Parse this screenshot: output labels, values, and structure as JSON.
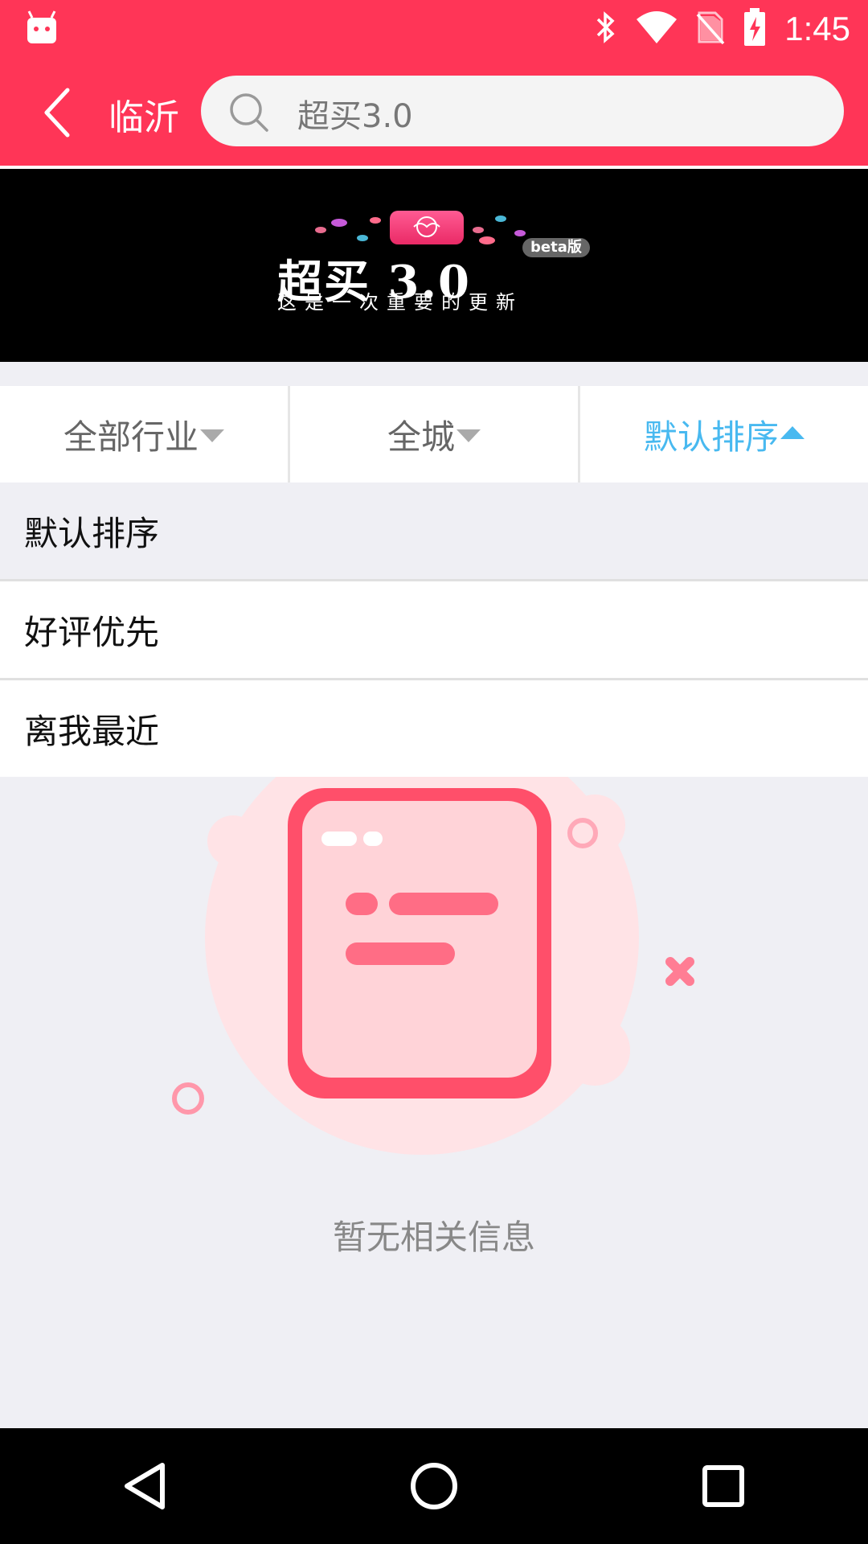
{
  "status_bar": {
    "time": "1:45",
    "icons": [
      "android-icon",
      "bluetooth-icon",
      "wifi-icon",
      "no-sim-icon",
      "battery-charging-icon"
    ]
  },
  "app_bar": {
    "city": "临沂",
    "search_text": "超买3.0",
    "accent_color": "#ff3557"
  },
  "banner": {
    "title": "超买 3.0",
    "badge": "beta版",
    "subtitle": "这是一次重要的更新"
  },
  "filters": {
    "industry": "全部行业",
    "area": "全城",
    "sort": "默认排序",
    "active_color": "#48b9f0"
  },
  "sort_options": [
    {
      "label": "默认排序",
      "selected": true
    },
    {
      "label": "好评优先",
      "selected": false
    },
    {
      "label": "离我最近",
      "selected": false
    }
  ],
  "empty_state": {
    "message": "暂无相关信息"
  },
  "nav_bar": {
    "buttons": [
      "back-icon",
      "home-icon",
      "recents-icon"
    ]
  }
}
